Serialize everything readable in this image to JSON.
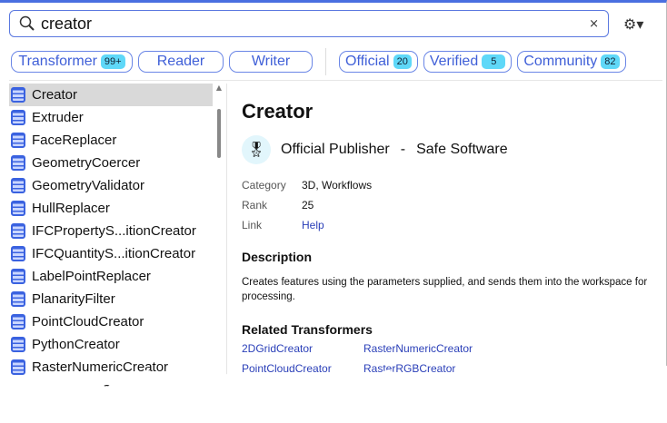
{
  "search": {
    "value": "creator",
    "clear": "×"
  },
  "settings": {
    "icon": "⚙▾"
  },
  "filters": [
    {
      "label": "Transformer",
      "count": "99+"
    },
    {
      "label": "Reader"
    },
    {
      "label": "Writer"
    },
    {
      "label": "Official",
      "count": "20"
    },
    {
      "label": "Verified",
      "count": "5"
    },
    {
      "label": "Community",
      "count": "82"
    }
  ],
  "list": [
    "Creator",
    "Extruder",
    "FaceReplacer",
    "GeometryCoercer",
    "GeometryValidator",
    "HullReplacer",
    "IFCPropertyS...itionCreator",
    "IFCQuantityS...itionCreator",
    "LabelPointReplacer",
    "PlanarityFilter",
    "PointCloudCreator",
    "PythonCreator",
    "RasterNumericCreator",
    "RasterRGBCreator"
  ],
  "detail": {
    "title": "Creator",
    "publisher_type": "Official Publisher",
    "separator": "-",
    "publisher": "Safe Software",
    "meta": [
      {
        "k": "Category",
        "v": "3D, Workflows"
      },
      {
        "k": "Rank",
        "v": "25"
      },
      {
        "k": "Link",
        "v": "Help"
      }
    ],
    "description_heading": "Description",
    "description": "Creates features using the parameters supplied, and sends them into the workspace for processing.",
    "related_heading": "Related Transformers",
    "related": [
      "2DGridCreator",
      "RasterNumericCreator",
      "PointCloudCreator",
      "RasterRGBCreator"
    ]
  }
}
